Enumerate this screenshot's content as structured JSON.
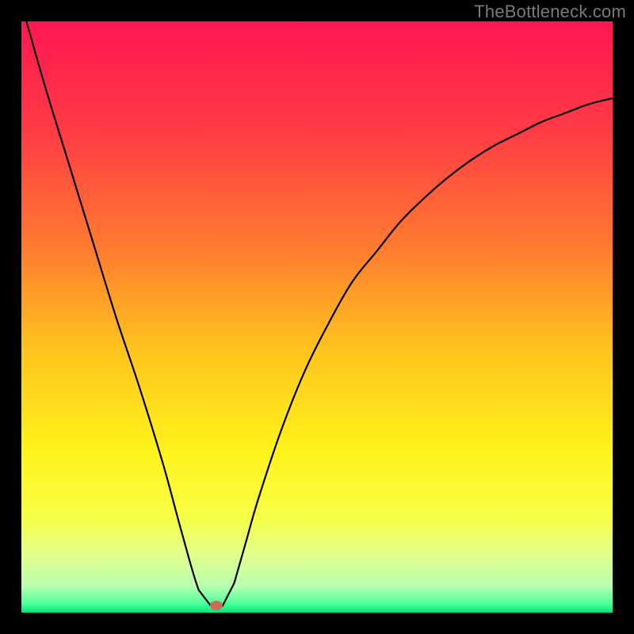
{
  "watermark": "TheBottleneck.com",
  "chart_data": {
    "type": "line",
    "title": "",
    "xlabel": "",
    "ylabel": "",
    "xlim": [
      0,
      100
    ],
    "ylim": [
      0,
      100
    ],
    "series": [
      {
        "name": "bottleneck-curve",
        "x": [
          0,
          4,
          8,
          12,
          16,
          20,
          24,
          27,
          30,
          32,
          34,
          36,
          38,
          40,
          44,
          48,
          52,
          56,
          60,
          64,
          68,
          72,
          76,
          80,
          84,
          88,
          92,
          96,
          100
        ],
        "values": [
          103,
          89,
          76,
          63,
          50,
          38,
          25,
          14,
          3.8,
          1.2,
          1.1,
          5,
          12,
          19,
          31,
          41,
          49,
          56,
          61,
          66,
          70,
          73.5,
          76.5,
          79,
          81,
          83,
          84.5,
          86,
          87
        ]
      }
    ],
    "marker": {
      "x": 33,
      "y": 1.2
    },
    "gradient_stops": [
      {
        "offset": 0.0,
        "color": "#ff1751"
      },
      {
        "offset": 0.18,
        "color": "#ff3a45"
      },
      {
        "offset": 0.38,
        "color": "#ff7a30"
      },
      {
        "offset": 0.55,
        "color": "#ffc21e"
      },
      {
        "offset": 0.72,
        "color": "#fff21a"
      },
      {
        "offset": 0.84,
        "color": "#f7ff45"
      },
      {
        "offset": 0.9,
        "color": "#e3ff8a"
      },
      {
        "offset": 0.955,
        "color": "#b9ffb0"
      },
      {
        "offset": 0.985,
        "color": "#4dff9c"
      },
      {
        "offset": 1.0,
        "color": "#00e77a"
      }
    ]
  }
}
